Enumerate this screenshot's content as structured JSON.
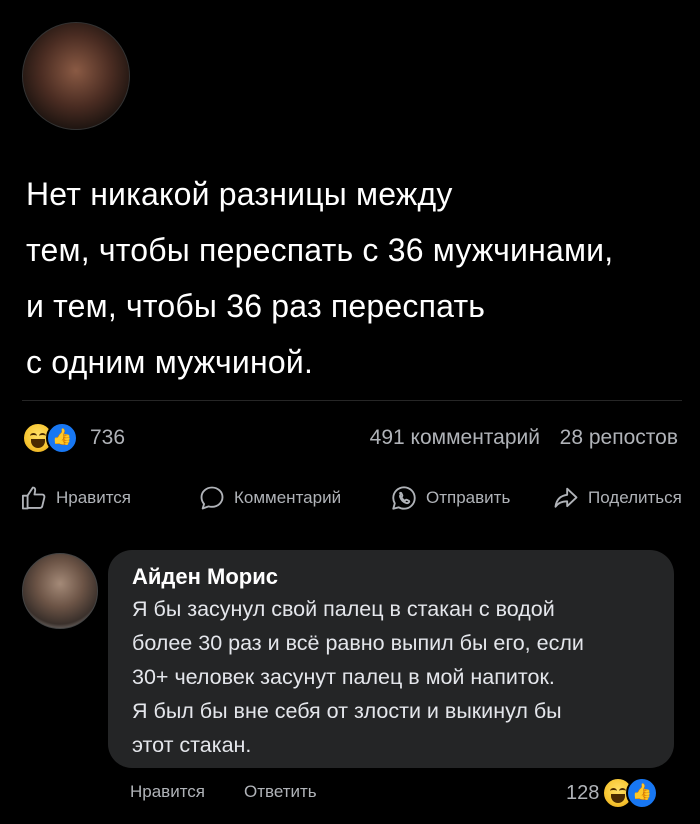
{
  "post": {
    "text_lines": [
      "Нет никакой разницы между",
      "тем, чтобы переспать с 36 мужчинами,",
      "и тем, чтобы 36 раз переспать",
      "с одним мужчиной."
    ]
  },
  "stats": {
    "reactions": "736",
    "comments": "491 комментарий",
    "reposts": "28 репостов",
    "reaction_icons": [
      "laugh-emoji",
      "like-thumb"
    ]
  },
  "actions": {
    "like": "Нравится",
    "comment": "Комментарий",
    "send": "Отправить",
    "share": "Поделиться"
  },
  "comment": {
    "author": "Айден Морис",
    "text_lines": [
      "Я бы засунул свой палец в стакан с водой",
      "более 30 раз и всё равно выпил бы его, если",
      "30+ человек засунут палец в мой напиток.",
      "Я был бы вне себя от злости и выкинул бы",
      "этот стакан."
    ],
    "like_label": "Нравится",
    "reply_label": "Ответить",
    "reaction_count": "128"
  },
  "colors": {
    "background": "#000000",
    "bubble": "#242526",
    "muted_text": "#b0b3b8",
    "like_blue": "#1877f2"
  }
}
